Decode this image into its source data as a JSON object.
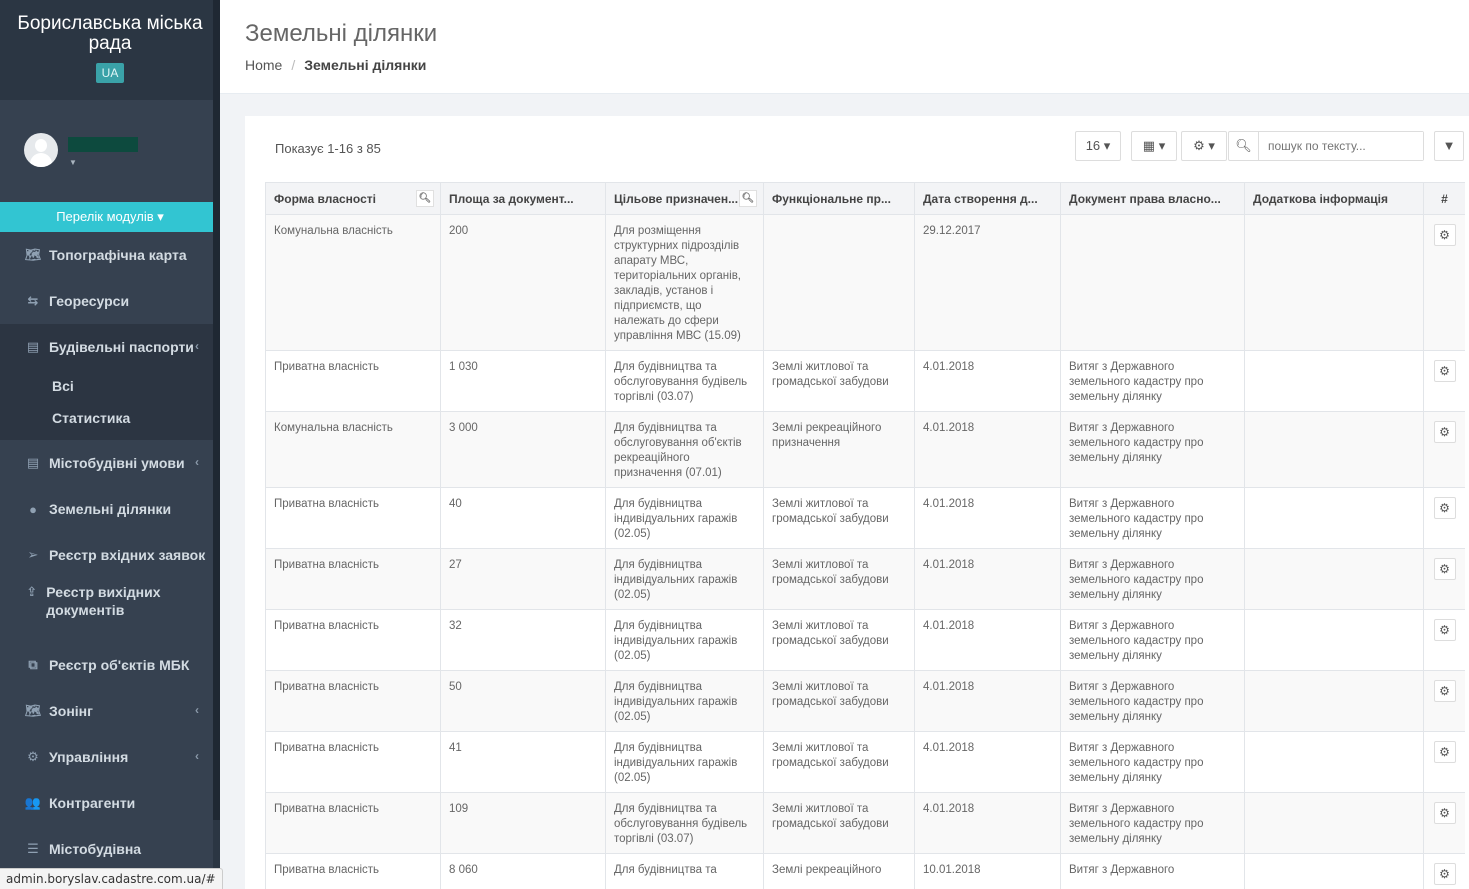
{
  "sidebar": {
    "title": "Бориславська міська рада",
    "lang": "UA",
    "modules_button": "Перелік модулів",
    "items": [
      {
        "label": "Топографічна карта",
        "icon": "map-icon"
      },
      {
        "label": "Георесурси",
        "icon": "retweet-icon"
      },
      {
        "label": "Будівельні паспорти",
        "icon": "building-icon",
        "open": true,
        "sub": [
          "Всі",
          "Статистика"
        ]
      },
      {
        "label": "Містобудівні умови",
        "icon": "building-icon"
      },
      {
        "label": "Земельні ділянки",
        "icon": "globe-icon"
      },
      {
        "label": "Реєстр вхідних заявок",
        "icon": "paper-plane-icon"
      },
      {
        "label": "Реєстр вихідних документів",
        "icon": "share-icon"
      },
      {
        "label": "Реєстр об'єктів МБК",
        "icon": "object-group-icon"
      },
      {
        "label": "Зонінг",
        "icon": "map-icon"
      },
      {
        "label": "Управління",
        "icon": "cogs-icon"
      },
      {
        "label": "Контрагенти",
        "icon": "users-icon"
      },
      {
        "label": "Містобудівна",
        "icon": "list-icon"
      }
    ]
  },
  "status_url": "admin.boryslav.cadastre.com.ua/#",
  "header": {
    "title": "Земельні ділянки",
    "breadcrumb_home": "Home",
    "breadcrumb_current": "Земельні ділянки"
  },
  "toolbar": {
    "showing": "Показує 1-16 з 85",
    "page_size": "16",
    "search_placeholder": "пошук по тексту..."
  },
  "table": {
    "columns": [
      "Форма власності",
      "Площа за документ...",
      "Цільове призначен...",
      "Функціональне пр...",
      "Дата створення д...",
      "Документ права власно...",
      "Додаткова інформація",
      "#"
    ],
    "rows": [
      [
        "Комунальна власність",
        "200",
        "Для розміщення структурних підрозділів апарату МВС, територіальних органів, закладів, установ і підприємств, що належать до сфери управління МВС (15.09)",
        "",
        "29.12.2017",
        "",
        ""
      ],
      [
        "Приватна власність",
        "1 030",
        "Для будівництва та обслуговування будівель торгівлі (03.07)",
        "Землі житлової та громадської забудови",
        "4.01.2018",
        "Витяг з Державного земельного кадастру про земельну ділянку",
        ""
      ],
      [
        "Комунальна власність",
        "3 000",
        "Для будівництва та обслуговування об'єктів рекреаційного призначення (07.01)",
        "Землі рекреаційного призначення",
        "4.01.2018",
        "Витяг з Державного земельного кадастру про земельну ділянку",
        ""
      ],
      [
        "Приватна власність",
        "40",
        "Для будівництва індивідуальних гаражів (02.05)",
        "Землі житлової та громадської забудови",
        "4.01.2018",
        "Витяг з Державного земельного кадастру про земельну ділянку",
        ""
      ],
      [
        "Приватна власність",
        "27",
        "Для будівництва індивідуальних гаражів (02.05)",
        "Землі житлової та громадської забудови",
        "4.01.2018",
        "Витяг з Державного земельного кадастру про земельну ділянку",
        ""
      ],
      [
        "Приватна власність",
        "32",
        "Для будівництва індивідуальних гаражів (02.05)",
        "Землі житлової та громадської забудови",
        "4.01.2018",
        "Витяг з Державного земельного кадастру про земельну ділянку",
        ""
      ],
      [
        "Приватна власність",
        "50",
        "Для будівництва індивідуальних гаражів (02.05)",
        "Землі житлової та громадської забудови",
        "4.01.2018",
        "Витяг з Державного земельного кадастру про земельну ділянку",
        ""
      ],
      [
        "Приватна власність",
        "41",
        "Для будівництва індивідуальних гаражів (02.05)",
        "Землі житлової та громадської забудови",
        "4.01.2018",
        "Витяг з Державного земельного кадастру про земельну ділянку",
        ""
      ],
      [
        "Приватна власність",
        "109",
        "Для будівництва та обслуговування будівель торгівлі (03.07)",
        "Землі житлової та громадської забудови",
        "4.01.2018",
        "Витяг з Державного земельного кадастру про земельну ділянку",
        ""
      ],
      [
        "Приватна власність",
        "8 060",
        "Для будівництва та",
        "Землі рекреаційного",
        "10.01.2018",
        "Витяг з Державного",
        ""
      ]
    ]
  },
  "colors": {
    "sidebar_bg": "#364150",
    "accent": "#32c5d2"
  }
}
